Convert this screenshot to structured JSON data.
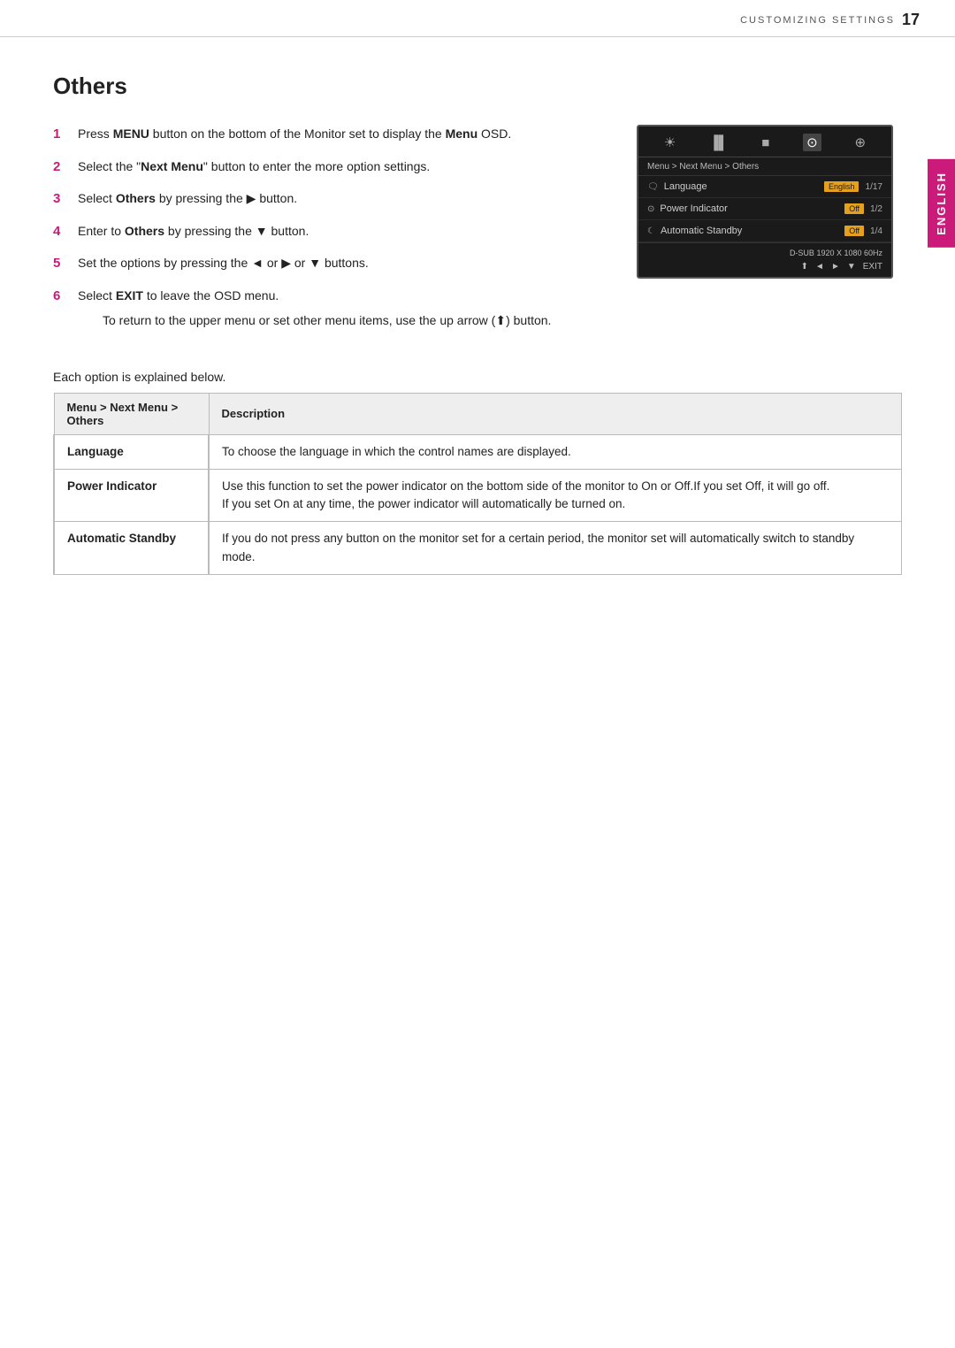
{
  "header": {
    "section_label": "CUSTOMIZING SETTINGS",
    "page_number": "17"
  },
  "english_tab": "ENGLISH",
  "page_title": "Others",
  "steps": [
    {
      "number": "1",
      "text": "Press ",
      "bold": "MENU",
      "text2": " button on the bottom of the Monitor set to display the ",
      "bold2": "Menu",
      "text3": " OSD.",
      "sub": null
    },
    {
      "number": "2",
      "text": "Select the \"",
      "bold": "Next Menu",
      "text2": "\" button to enter the more option settings.",
      "bold2": null,
      "text3": null,
      "sub": null
    },
    {
      "number": "3",
      "text": "Select ",
      "bold": "Others",
      "text2": " by pressing the ▶ button.",
      "bold2": null,
      "text3": null,
      "sub": null
    },
    {
      "number": "4",
      "text": "Enter to ",
      "bold": "Others",
      "text2": " by pressing the ▼ button.",
      "bold2": null,
      "text3": null,
      "sub": null
    },
    {
      "number": "5",
      "text": "Set the options by pressing the ◄ or ▶ or ▼ buttons.",
      "bold": null,
      "text2": null,
      "bold2": null,
      "text3": null,
      "sub": null
    },
    {
      "number": "6",
      "text": "Select ",
      "bold": "EXIT",
      "text2": " to leave the OSD menu.",
      "bold2": null,
      "text3": null,
      "sub": "To return to the upper menu or set other menu items, use the up arrow (⬆) button."
    }
  ],
  "each_option_text": "Each option is explained below.",
  "osd": {
    "breadcrumb": "Menu > Next Menu > Others",
    "icons": [
      "☀",
      "▐▌",
      "■",
      "⊙",
      "⊕"
    ],
    "rows": [
      {
        "icon": "🗨",
        "label": "Language",
        "value": "English",
        "count": "1/17"
      },
      {
        "icon": "⊙",
        "label": "Power Indicator",
        "value": "Off",
        "count": "1/2"
      },
      {
        "icon": "☾",
        "label": "Automatic Standby",
        "value": "Off",
        "count": "1/4"
      }
    ],
    "footer_resolution": "D-SUB 1920 X 1080 60Hz",
    "footer_nav": [
      "⬆",
      "◄",
      "►",
      "▼",
      "EXIT"
    ]
  },
  "table": {
    "col1_header": "Menu > Next Menu > Others",
    "col2_header": "Description",
    "rows": [
      {
        "menu_item": "Language",
        "description": "To choose the language in which the control names are displayed."
      },
      {
        "menu_item": "Power Indicator",
        "description": "Use this function to set the power indicator on the bottom side of the monitor to On or Off.If you set Off, it will go off.\nIf you set On at any time, the power indicator will automatically be turned on."
      },
      {
        "menu_item": "Automatic Standby",
        "description": "If you do not press any button on the monitor set for a certain period, the monitor set will automatically switch to standby mode."
      }
    ]
  }
}
